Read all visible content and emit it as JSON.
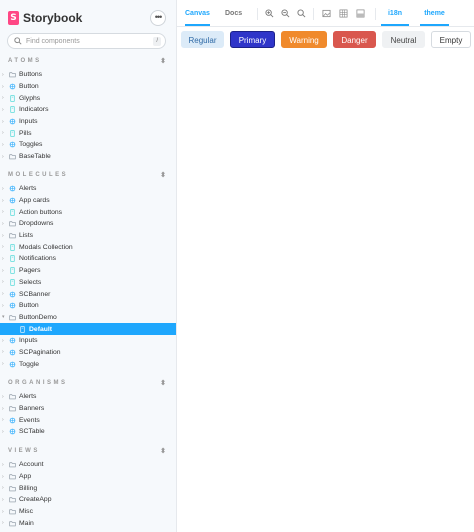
{
  "app": {
    "name": "Storybook",
    "logo_letter": "S",
    "menu_label": "•••"
  },
  "search": {
    "placeholder": "Find components",
    "shortcut": "/"
  },
  "sections": [
    {
      "title": "ATOMS",
      "items": [
        {
          "label": "Buttons",
          "icon": "folder-icon",
          "expanded": false
        },
        {
          "label": "Button",
          "icon": "component-icon",
          "expanded": false
        },
        {
          "label": "Glyphs",
          "icon": "story-icon",
          "expanded": false
        },
        {
          "label": "Indicators",
          "icon": "story-icon",
          "expanded": false
        },
        {
          "label": "Inputs",
          "icon": "component-icon",
          "expanded": false
        },
        {
          "label": "Pills",
          "icon": "story-icon",
          "expanded": false
        },
        {
          "label": "Toggles",
          "icon": "component-icon",
          "expanded": false
        },
        {
          "label": "BaseTable",
          "icon": "folder-icon",
          "expanded": false
        }
      ]
    },
    {
      "title": "MOLECULES",
      "items": [
        {
          "label": "Alerts",
          "icon": "component-icon",
          "expanded": false
        },
        {
          "label": "App cards",
          "icon": "component-icon",
          "expanded": false
        },
        {
          "label": "Action buttons",
          "icon": "story-icon",
          "expanded": false
        },
        {
          "label": "Dropdowns",
          "icon": "folder-icon",
          "expanded": false
        },
        {
          "label": "Lists",
          "icon": "folder-icon",
          "expanded": false
        },
        {
          "label": "Modals Collection",
          "icon": "story-icon",
          "expanded": false
        },
        {
          "label": "Notifications",
          "icon": "story-icon",
          "expanded": false
        },
        {
          "label": "Pagers",
          "icon": "story-icon",
          "expanded": false
        },
        {
          "label": "Selects",
          "icon": "story-icon",
          "expanded": false
        },
        {
          "label": "SCBanner",
          "icon": "component-icon",
          "expanded": false
        },
        {
          "label": "Button",
          "icon": "component-icon",
          "expanded": false
        },
        {
          "label": "ButtonDemo",
          "icon": "folder-icon",
          "expanded": true
        },
        {
          "label": "Default",
          "icon": "story-icon",
          "child": true,
          "selected": true
        },
        {
          "label": "Inputs",
          "icon": "component-icon",
          "expanded": false
        },
        {
          "label": "SCPagination",
          "icon": "component-icon",
          "expanded": false
        },
        {
          "label": "Toggle",
          "icon": "component-icon",
          "expanded": false
        }
      ]
    },
    {
      "title": "ORGANISMS",
      "items": [
        {
          "label": "Alerts",
          "icon": "folder-icon",
          "expanded": false
        },
        {
          "label": "Banners",
          "icon": "folder-icon",
          "expanded": false
        },
        {
          "label": "Events",
          "icon": "component-icon",
          "expanded": false
        },
        {
          "label": "SCTable",
          "icon": "component-icon",
          "expanded": false
        }
      ]
    },
    {
      "title": "VIEWS",
      "items": [
        {
          "label": "Account",
          "icon": "folder-icon",
          "expanded": false
        },
        {
          "label": "App",
          "icon": "folder-icon",
          "expanded": false
        },
        {
          "label": "Billing",
          "icon": "folder-icon",
          "expanded": false
        },
        {
          "label": "CreateApp",
          "icon": "folder-icon",
          "expanded": false
        },
        {
          "label": "Misc",
          "icon": "folder-icon",
          "expanded": false
        },
        {
          "label": "Main",
          "icon": "folder-icon",
          "expanded": false
        }
      ]
    }
  ],
  "toolbar": {
    "tabs": [
      {
        "label": "Canvas",
        "active": true
      },
      {
        "label": "Docs",
        "active": false
      }
    ],
    "tools": [
      "zoom-in-icon",
      "zoom-out-icon",
      "zoom-reset-icon",
      "image-icon",
      "grid-icon",
      "background-icon"
    ],
    "addons": [
      {
        "label": "i18n",
        "active": true
      },
      {
        "label": "theme",
        "active": true
      }
    ]
  },
  "canvas": {
    "buttons": [
      {
        "label": "Regular",
        "bg": "#dcebf8",
        "fg": "#2f6aa6",
        "border": "#dcebf8"
      },
      {
        "label": "Primary",
        "bg": "#2f35c9",
        "fg": "#ffffff",
        "border": "#1c218a"
      },
      {
        "label": "Warning",
        "bg": "#f08a2c",
        "fg": "#ffffff",
        "border": "#f08a2c"
      },
      {
        "label": "Danger",
        "bg": "#d9574e",
        "fg": "#ffffff",
        "border": "#d9574e"
      },
      {
        "label": "Neutral",
        "bg": "#eff1f3",
        "fg": "#444444",
        "border": "#eff1f3"
      },
      {
        "label": "Empty",
        "bg": "#ffffff",
        "fg": "#333333",
        "border": "#d6dbe0"
      }
    ]
  },
  "colors": {
    "accent": "#1ea7fd",
    "brand": "#ff4785",
    "sidebar_bg": "#f6f9fc"
  }
}
